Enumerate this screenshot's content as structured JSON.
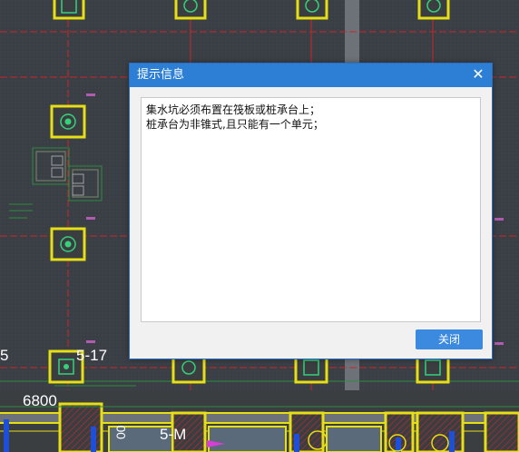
{
  "drawing": {
    "labels": {
      "axis_number": "5-17",
      "axis_left_fragment": "5",
      "dimension": "6800",
      "axis_bottom": "5-M",
      "bottom_vertical_number": "00"
    }
  },
  "dialog": {
    "title": "提示信息",
    "close_icon": "close-icon",
    "messages": [
      "集水坑必须布置在筏板或桩承台上；",
      "桩承台为非锥式,且只能有一个单元；"
    ],
    "close_button_label": "关闭"
  },
  "colors": {
    "canvas_background": "#3a3f45",
    "pile_cap": "#e6df16",
    "pile_center": "#37d07a",
    "axis_line": "#c8272b",
    "dialog_header": "#2d7fd6",
    "button": "#3b8ae0"
  }
}
